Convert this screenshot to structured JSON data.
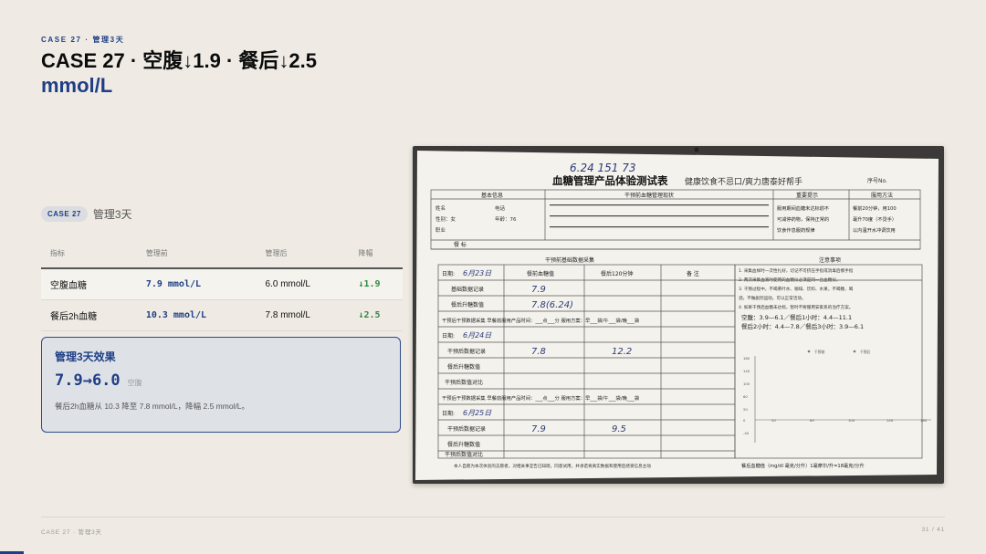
{
  "header": {
    "eyebrow": "CASE 27 · 管理3天",
    "title": "CASE 27 · 空腹↓1.9 · 餐后↓2.5",
    "unit": "mmol/L"
  },
  "case": {
    "badge": "CASE 27",
    "label": "管理3天"
  },
  "table": {
    "headers": [
      "指标",
      "管理前",
      "管理后",
      "降幅"
    ],
    "rows": [
      {
        "name": "空腹血糖",
        "before": "7.9 mmol/L",
        "after": "6.0 mmol/L",
        "drop": "↓1.9"
      },
      {
        "name": "餐后2h血糖",
        "before": "10.3 mmol/L",
        "after": "7.8 mmol/L",
        "drop": "↓2.5"
      }
    ]
  },
  "effect": {
    "title": "管理3天效果",
    "value": "7.9→6.0",
    "sub": "空腹",
    "desc": "餐后2h血糖从 10.3 降至 7.8 mmol/L，降幅 2.5 mmol/L。"
  },
  "photo": {
    "handwritten_top": "6.24  151  73",
    "form_title": "血糖管理产品体验测试表",
    "slogan": "健康饮食不忌口/爽力唐泰好帮手",
    "serial": "序号No.",
    "basic_info": "基本信息",
    "section_pre": "干预前血糖管理现状",
    "section_hint": "重要提示",
    "section_method": "服用方法",
    "hint_text": [
      "服用期间血糖未达标前不",
      "可减停药物，保持正常的",
      "饮食作息服药规律"
    ],
    "method_text": [
      "餐前20分钟，用100",
      "毫升70度（不烫手）",
      "以内温开水冲调饮用"
    ],
    "fields": [
      "姓名",
      "性别：女",
      "职业",
      "年龄：76",
      "电话"
    ],
    "meal_row": "餐    标",
    "section_data": "干预前基础数据采集",
    "section_notes": "注意事项",
    "col_fasting": "餐前血糖值",
    "col_after": "餐后120分钟",
    "col_remark": "备  注",
    "date_label": "日期:",
    "day1_date": "6月23日",
    "day2_date": "6月24日",
    "day3_date": "6月25日",
    "row_record": "基础数据记录",
    "row_rise": "餐后升糖数值",
    "row_rec2": "干预后数据记录",
    "row_rise2": "餐后升糖数值",
    "row_cmp": "干预后数值对比",
    "d1_fast": "7.9",
    "d1_after": "7.8(6.24)",
    "d2_fast": "7.8",
    "d2_after": "12.2",
    "d3_fast": "7.9",
    "d3_after": "9.5",
    "notes": [
      "1. 采集血样时一次性扎好，切记不可挤压手指或消毒后擦手指",
      "2. 两次采集血液时使用的血糖仪必须是同一台血糖仪。",
      "3. 干预过程中，不喝茶叶水、咖啡、饮料、水果，不喝糖、喝",
      "酒，不做剧烈运动，可以正常活动。",
      "4. 如果干预后血糖未达标，暂时不要服用安家系的治疗方案。"
    ],
    "ref_line1": "空腹：3.9—6.1／餐后1小时：4.4—11.1",
    "ref_line2": "餐后2小时：4.4—7.8／餐后3小时：3.9—6.1",
    "collection_row": "干预后干预数据采集   早餐前服用产品时间：___点___分   服用方案：早___袋/午___袋/晚___袋",
    "chart_legend": [
      "干预前",
      "干预后"
    ],
    "chart_y": [
      "180",
      "160",
      "140",
      "120",
      "100",
      "80",
      "60",
      "40",
      "20",
      "0",
      "-20",
      "-40",
      "-60",
      "-80"
    ],
    "chart_x": [
      "20",
      "40",
      "60",
      "80",
      "100",
      "120",
      "140",
      "160",
      "180"
    ],
    "chart_units": "餐后血糖值（mg/dl 毫克/分升）1毫摩尔/升=18毫克/分升",
    "footer_text": "本人自愿为本次体验的志愿者，对相关事宜告已知晓，同意试用，并承诺将真实数据和使用后感受信息主动"
  },
  "footer": {
    "left": "CASE 27 · 管理3天",
    "right": "31 / 41"
  },
  "colors": {
    "accent": "#1e3f86",
    "green": "#2e8a44",
    "background": "#efebe4"
  }
}
